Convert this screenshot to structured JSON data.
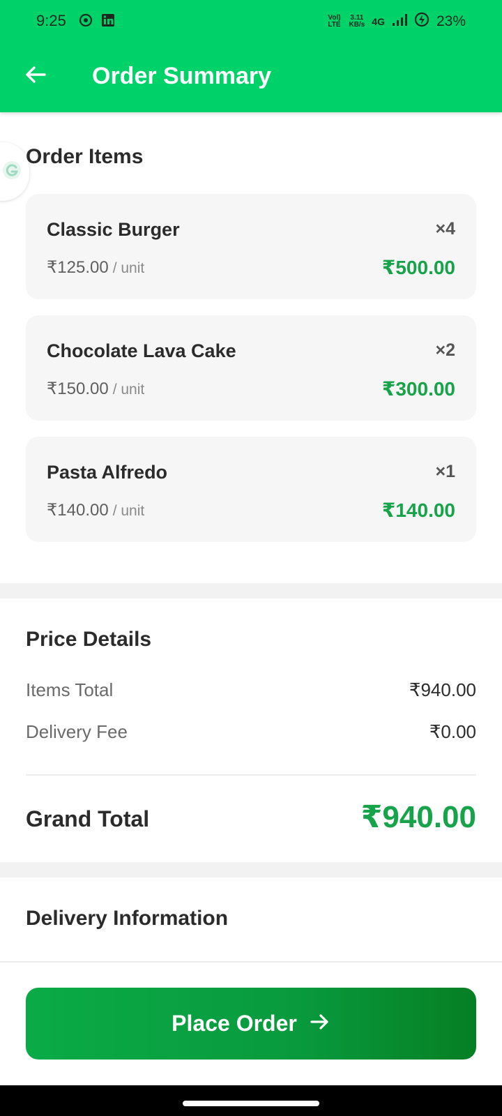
{
  "status_bar": {
    "time": "9:25",
    "network_label_1": "Vol) LTE",
    "speed_value": "3.11",
    "speed_unit": "KB/s",
    "network_type": "4G",
    "battery": "23%",
    "icons": [
      "whatsapp-icon",
      "linkedin-icon",
      "signal-icon",
      "battery-saver-icon"
    ]
  },
  "header": {
    "title": "Order Summary",
    "back_icon": "arrow-left-icon",
    "color": "#00d26a"
  },
  "order_items": {
    "title": "Order Items",
    "items": [
      {
        "name": "Classic Burger",
        "qty": "×4",
        "unit_price": "₹125.00",
        "unit_label": "/ unit",
        "total": "₹500.00"
      },
      {
        "name": "Chocolate Lava Cake",
        "qty": "×2",
        "unit_price": "₹150.00",
        "unit_label": "/ unit",
        "total": "₹300.00"
      },
      {
        "name": "Pasta Alfredo",
        "qty": "×1",
        "unit_price": "₹140.00",
        "unit_label": "/ unit",
        "total": "₹140.00"
      }
    ]
  },
  "price_details": {
    "title": "Price Details",
    "items_total_label": "Items Total",
    "items_total_value": "₹940.00",
    "delivery_fee_label": "Delivery Fee",
    "delivery_fee_value": "₹0.00",
    "grand_total_label": "Grand Total",
    "grand_total_value": "₹940.00"
  },
  "delivery": {
    "title": "Delivery Information"
  },
  "actions": {
    "place_order_label": "Place Order",
    "place_order_icon": "arrow-right-icon"
  },
  "colors": {
    "accent_green": "#16a34a",
    "button_green": "#0aab46"
  }
}
